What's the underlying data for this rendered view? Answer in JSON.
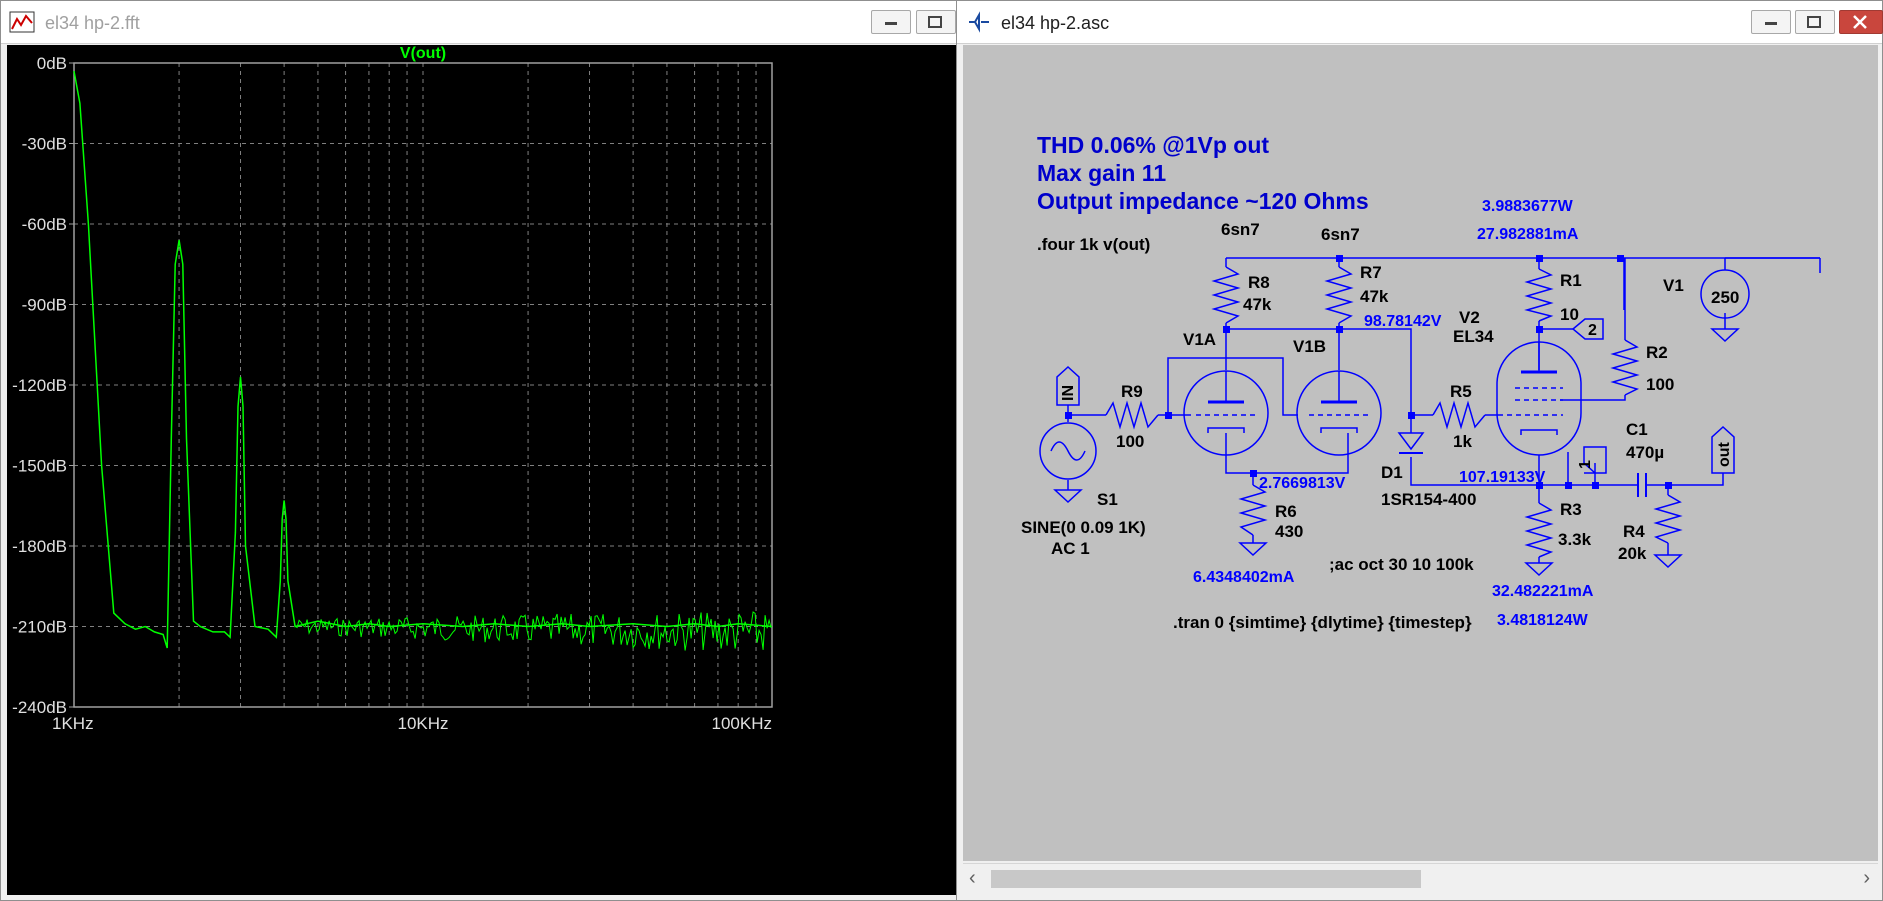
{
  "fft_window": {
    "title": "el34 hp-2.fft"
  },
  "schematic_window": {
    "title": "el34 hp-2.asc"
  },
  "chart_data": {
    "type": "line",
    "title": "V(out)",
    "xlabel": "",
    "ylabel": "",
    "x_scale": "log",
    "xlim": [
      1,
      100
    ],
    "ylim": [
      -240,
      0
    ],
    "y_ticks": [
      "0dB",
      "-30dB",
      "-60dB",
      "-90dB",
      "-120dB",
      "-150dB",
      "-180dB",
      "-210dB",
      "-240dB"
    ],
    "x_ticks": [
      "1KHz",
      "10KHz",
      "100KHz"
    ],
    "grid": true,
    "series": [
      {
        "name": "V(out)",
        "color": "#00ff00",
        "x": [
          1.0,
          1.04,
          1.1,
          1.2,
          1.3,
          1.4,
          1.5,
          1.6,
          1.7,
          1.8,
          1.85,
          1.9,
          1.95,
          2.0,
          2.05,
          2.1,
          2.2,
          2.3,
          2.5,
          2.7,
          2.8,
          2.9,
          2.95,
          3.0,
          3.05,
          3.1,
          3.3,
          3.6,
          3.8,
          3.9,
          3.95,
          4.0,
          4.05,
          4.1,
          4.3,
          5,
          6,
          7,
          8,
          10,
          13,
          16,
          20,
          25,
          30,
          40,
          50,
          60,
          70,
          80,
          100
        ],
        "y": [
          -3,
          -15,
          -60,
          -150,
          -205,
          -209,
          -211,
          -210,
          -212,
          -213,
          -218,
          -140,
          -75,
          -66,
          -75,
          -140,
          -208,
          -210,
          -212,
          -212,
          -214,
          -175,
          -128,
          -117,
          -128,
          -180,
          -210,
          -211,
          -214,
          -193,
          -170,
          -163,
          -170,
          -193,
          -210,
          -208,
          -210,
          -209,
          -210,
          -209,
          -210,
          -209,
          -210,
          -209,
          -210,
          -209,
          -210,
          -209,
          -210,
          -209,
          -210
        ]
      }
    ]
  },
  "schematic": {
    "notes": {
      "thd": "THD 0.06% @1Vp out",
      "gain": "Max gain 11",
      "impedance": "Output impedance ~120 Ohms",
      "four": ".four 1k v(out)",
      "ac": ";ac oct 30 10 100k",
      "tran": ".tran 0 {simtime} {dlytime} {timestep}"
    },
    "tube_models": {
      "a": "6sn7",
      "b": "6sn7"
    },
    "components": {
      "r8": {
        "name": "R8",
        "value": "47k"
      },
      "r7": {
        "name": "R7",
        "value": "47k"
      },
      "r1": {
        "name": "R1",
        "value": "10"
      },
      "r2": {
        "name": "R2",
        "value": "100"
      },
      "r9": {
        "name": "R9",
        "value": "100"
      },
      "r5": {
        "name": "R5",
        "value": "1k"
      },
      "r6": {
        "name": "R6",
        "value": "430"
      },
      "r3": {
        "name": "R3",
        "value": "3.3k"
      },
      "r4": {
        "name": "R4",
        "value": "20k"
      },
      "c1": {
        "name": "C1",
        "value": "470µ"
      },
      "d1": {
        "name": "D1",
        "value": "1SR154-400"
      },
      "v1": {
        "name": "V1",
        "value": "250"
      },
      "v1a": {
        "name": "V1A"
      },
      "v1b": {
        "name": "V1B"
      },
      "v2": {
        "name": "V2",
        "value": "EL34"
      },
      "s1": {
        "name": "S1",
        "value": "SINE(0 0.09 1K)",
        "ac": "AC 1"
      }
    },
    "labels": {
      "in": "IN",
      "out": "out",
      "n1": "1",
      "n2": "2"
    },
    "measurements": {
      "power_top": "3.9883677W",
      "current_top": "27.982881mA",
      "v_plate": "98.78142V",
      "v_cathode": "2.7669813V",
      "v_out_node": "107.19133V",
      "i_r6": "6.4348402mA",
      "i_r3": "32.482221mA",
      "p_r3": "3.4818124W"
    },
    "colors": {
      "wire": "#0000ff",
      "text": "#000000",
      "measure": "#0000ff",
      "background": "#c0c0c0"
    }
  }
}
